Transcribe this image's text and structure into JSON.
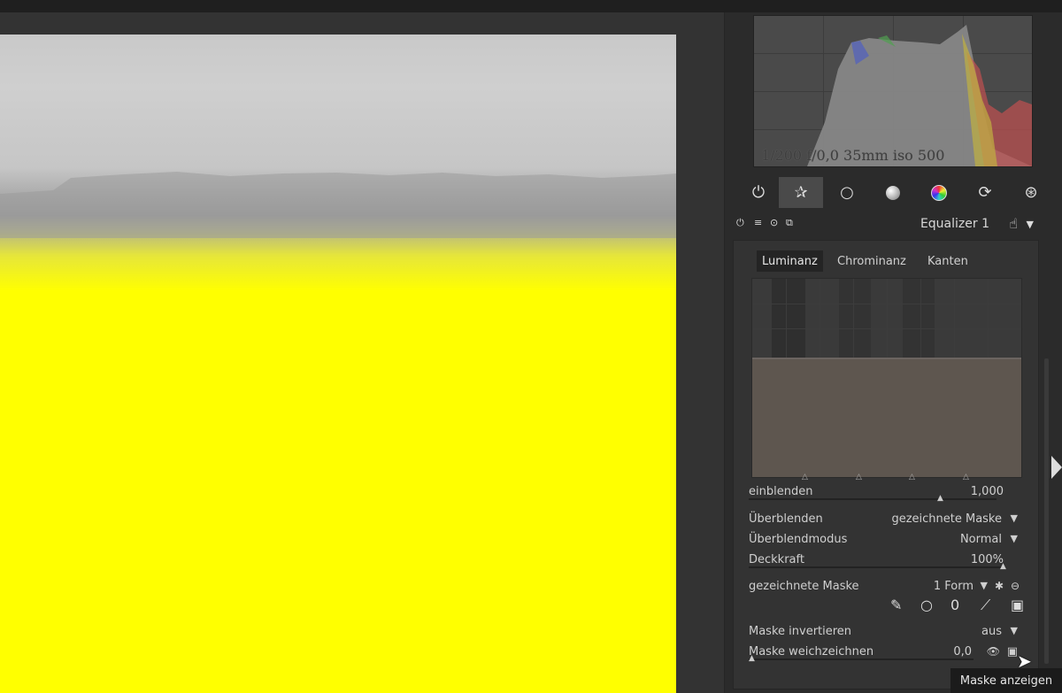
{
  "histogram": {
    "exif": "1/200 f/0,0 35mm iso 500"
  },
  "module_groups": [
    "power-icon",
    "star-icon",
    "circle-icon",
    "gradient-circle-icon",
    "color-wheel-icon",
    "refresh-icon",
    "aperture-icon"
  ],
  "module": {
    "name": "Equalizer 1"
  },
  "tabs": [
    "Luminanz",
    "Chrominanz",
    "Kanten"
  ],
  "params": {
    "einblenden": {
      "label": "einblenden",
      "value": "1,000",
      "level": 0.88
    },
    "ueberblenden": {
      "label": "Überblenden",
      "value": "gezeichnete Maske"
    },
    "ueberblendmodus": {
      "label": "Überblendmodus",
      "value": "Normal"
    },
    "deckkraft": {
      "label": "Deckkraft",
      "value": "100%",
      "level": 1.0
    },
    "gezeichnete_maske": {
      "label": "gezeichnete Maske",
      "value": "1 Form"
    },
    "maske_invertieren": {
      "label": "Maske invertieren",
      "value": "aus"
    },
    "maske_weichzeichnen": {
      "label": "Maske weichzeichnen",
      "value": "0,0",
      "level": 0.0
    }
  },
  "tooltip": "Maske anzeigen",
  "colors": {
    "image_yellow": "#ffff00",
    "panel_bg": "#333333"
  }
}
